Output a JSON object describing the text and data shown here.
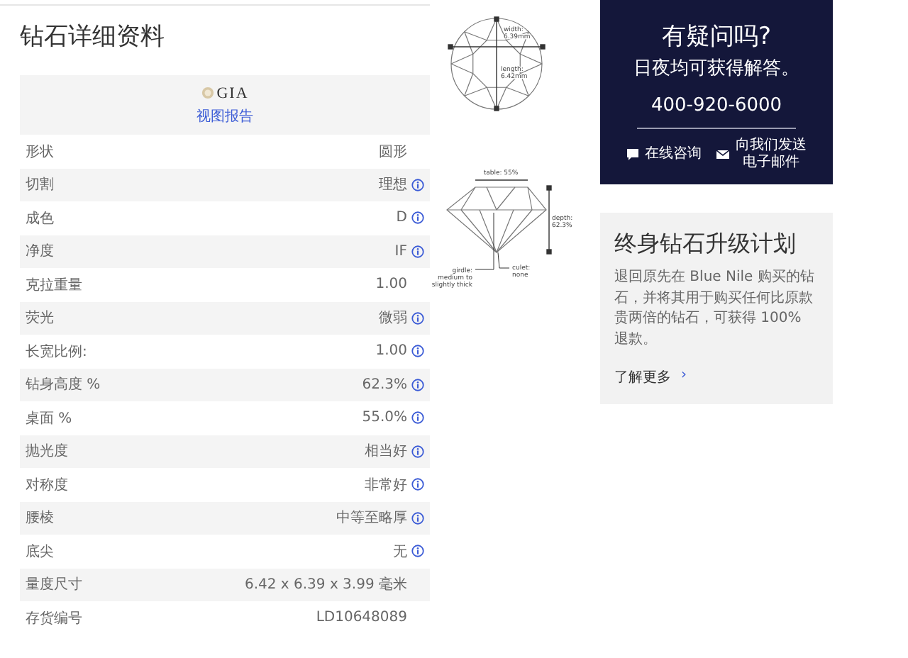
{
  "page_title": "钻石详细资料",
  "certificate": {
    "logo": "GIA",
    "link": "视图报告"
  },
  "specs": [
    {
      "label": "形状",
      "value": "圆形",
      "info": false
    },
    {
      "label": "切割",
      "value": "理想",
      "info": true
    },
    {
      "label": "成色",
      "value": "D",
      "info": true
    },
    {
      "label": "净度",
      "value": "IF",
      "info": true
    },
    {
      "label": "克拉重量",
      "value": "1.00",
      "info": false
    },
    {
      "label": "荧光",
      "value": "微弱",
      "info": true
    },
    {
      "label": "长宽比例:",
      "value": "1.00",
      "info": true
    },
    {
      "label": "钻身高度 %",
      "value": "62.3%",
      "info": true
    },
    {
      "label": "桌面 %",
      "value": "55.0%",
      "info": true
    },
    {
      "label": "抛光度",
      "value": "相当好",
      "info": true
    },
    {
      "label": "对称度",
      "value": "非常好",
      "info": true
    },
    {
      "label": "腰棱",
      "value": "中等至略厚",
      "info": true
    },
    {
      "label": "底尖",
      "value": "无",
      "info": true
    },
    {
      "label": "量度尺寸",
      "value": "6.42 x 6.39 x 3.99 毫米",
      "info": false
    },
    {
      "label": "存货编号",
      "value": "LD10648089",
      "info": false
    }
  ],
  "diagrams": {
    "top_view": {
      "width_label": [
        "width:",
        "6.39mm"
      ],
      "length_label": [
        "length:",
        "6.42mm"
      ]
    },
    "side_view": {
      "table_label": [
        "table: 55%"
      ],
      "depth_label": [
        "depth:",
        "62.3%"
      ],
      "girdle_label": [
        "girdle:",
        "medium to",
        "slightly thick"
      ],
      "culet_label": [
        "culet:",
        "none"
      ]
    }
  },
  "contact": {
    "title": "有疑问吗?",
    "subtitle": "日夜均可获得解答。",
    "phone": "400-920-6000",
    "chat": "在线咨询",
    "email": [
      "向我们发送",
      "电子邮件"
    ]
  },
  "upgrade": {
    "title": "终身钻石升级计划",
    "body": "退回原先在 Blue Nile 购买的钻石，并将其用于购买任何比原款贵两倍的钻石，可获得 100% 退款。",
    "link": "了解更多",
    "link_arrow": "›"
  }
}
